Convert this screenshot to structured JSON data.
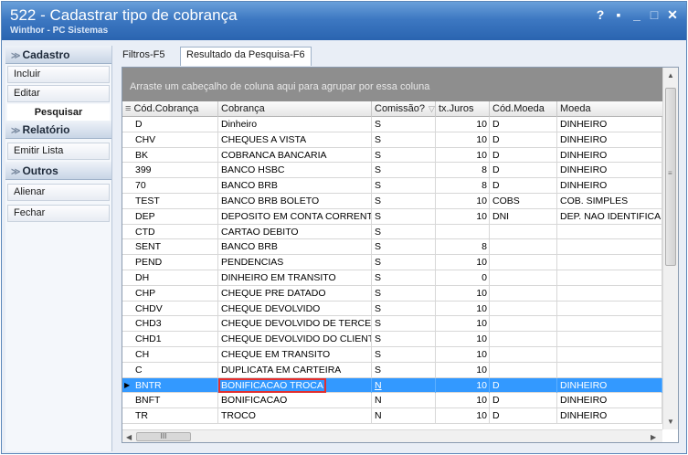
{
  "window": {
    "title": "522 - Cadastrar tipo de cobrança",
    "subtitle": "Winthor - PC Sistemas",
    "controls": {
      "help": "?",
      "restore": "▪",
      "minimize": "_",
      "maximize": "□",
      "close": "✕"
    }
  },
  "sidebar": {
    "sections": [
      {
        "header": "Cadastro",
        "items": [
          "Incluir",
          "Editar"
        ],
        "extra": "Pesquisar"
      },
      {
        "header": "Relatório",
        "items": [
          "Emitir Lista"
        ]
      },
      {
        "header": "Outros",
        "items": [
          "Alienar",
          "Fechar"
        ]
      }
    ]
  },
  "tabs": [
    {
      "label": "Filtros-F5",
      "active": false
    },
    {
      "label": "Resultado da Pesquisa-F6",
      "active": true
    }
  ],
  "grid": {
    "group_hint": "Arraste um cabeçalho de coluna aqui para agrupar por essa coluna",
    "columns": [
      "Cód.Cobrança",
      "Cobrança",
      "Comissão?",
      "tx.Juros",
      "Cód.Moeda",
      "Moeda"
    ],
    "rows": [
      [
        "D",
        "Dinheiro",
        "S",
        "10",
        "D",
        "DINHEIRO"
      ],
      [
        "CHV",
        "CHEQUES A VISTA",
        "S",
        "10",
        "D",
        "DINHEIRO"
      ],
      [
        "BK",
        "COBRANCA BANCARIA",
        "S",
        "10",
        "D",
        "DINHEIRO"
      ],
      [
        "399",
        "BANCO HSBC",
        "S",
        "8",
        "D",
        "DINHEIRO"
      ],
      [
        "70",
        "BANCO BRB",
        "S",
        "8",
        "D",
        "DINHEIRO"
      ],
      [
        "TEST",
        "BANCO BRB BOLETO",
        "S",
        "10",
        "COBS",
        "COB. SIMPLES"
      ],
      [
        "DEP",
        "DEPOSITO EM CONTA CORRENTE",
        "S",
        "10",
        "DNI",
        "DEP. NAO IDENTIFICAD"
      ],
      [
        "CTD",
        "CARTAO DEBITO",
        "S",
        "",
        "",
        ""
      ],
      [
        "SENT",
        "BANCO BRB",
        "S",
        "8",
        "",
        ""
      ],
      [
        "PEND",
        "PENDENCIAS",
        "S",
        "10",
        "",
        ""
      ],
      [
        "DH",
        "DINHEIRO EM TRANSITO",
        "S",
        "0",
        "",
        ""
      ],
      [
        "CHP",
        "CHEQUE PRE DATADO",
        "S",
        "10",
        "",
        ""
      ],
      [
        "CHDV",
        "CHEQUE DEVOLVIDO",
        "S",
        "10",
        "",
        ""
      ],
      [
        "CHD3",
        "CHEQUE DEVOLVIDO DE TERCEIROS",
        "S",
        "10",
        "",
        ""
      ],
      [
        "CHD1",
        "CHEQUE DEVOLVIDO DO CLIENTE",
        "S",
        "10",
        "",
        ""
      ],
      [
        "CH",
        "CHEQUE EM TRANSITO",
        "S",
        "10",
        "",
        ""
      ],
      [
        "C",
        "DUPLICATA EM CARTEIRA",
        "S",
        "10",
        "",
        ""
      ],
      [
        "BNTR",
        "BONIFICACAO TROCA",
        "N",
        "10",
        "D",
        "DINHEIRO"
      ],
      [
        "BNFT",
        "BONIFICACAO",
        "N",
        "10",
        "D",
        "DINHEIRO"
      ],
      [
        "TR",
        "TROCO",
        "N",
        "10",
        "D",
        "DINHEIRO"
      ]
    ],
    "selected_row": 17,
    "hscroll_label": "III"
  },
  "colors": {
    "title_bar": "#3d78c2",
    "selection": "#3399ff",
    "highlight_box": "#e03030",
    "group_panel": "#8e8e8e"
  }
}
